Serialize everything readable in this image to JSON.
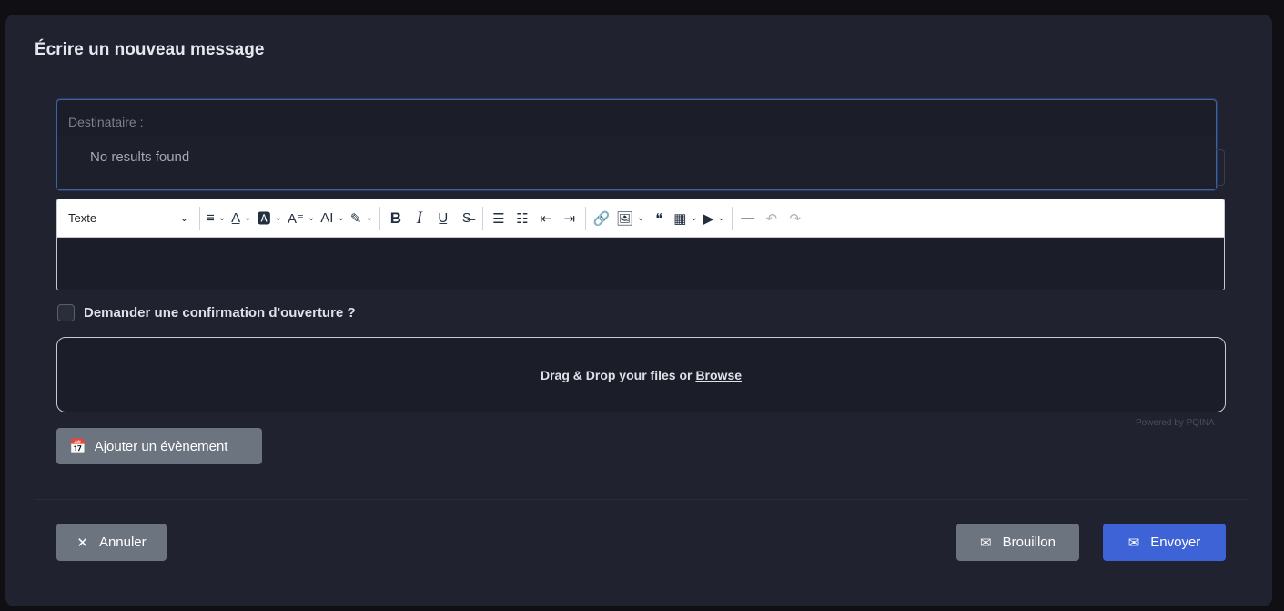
{
  "modal": {
    "title": "Écrire un nouveau message"
  },
  "recipient": {
    "label": "Destinataire :",
    "dropdown_message": "No results found"
  },
  "toolbar": {
    "format_select": "Texte",
    "buttons": [
      {
        "name": "align-icon",
        "glyph": "≡",
        "caret": true
      },
      {
        "name": "text-color-icon",
        "glyph": "A̲",
        "caret": true
      },
      {
        "name": "background-color-icon",
        "glyph": "🅰",
        "caret": true
      },
      {
        "name": "font-family-icon",
        "glyph": "A⁼",
        "caret": true
      },
      {
        "name": "font-size-icon",
        "glyph": "AI",
        "caret": true
      },
      {
        "name": "highlight-icon",
        "glyph": "✎",
        "caret": true
      },
      {
        "name": "bold-icon",
        "glyph": "B"
      },
      {
        "name": "italic-icon",
        "glyph": "I"
      },
      {
        "name": "underline-icon",
        "glyph": "U̲"
      },
      {
        "name": "strikethrough-icon",
        "glyph": "S̶"
      },
      {
        "name": "bullet-list-icon",
        "glyph": "☰"
      },
      {
        "name": "numbered-list-icon",
        "glyph": "☷"
      },
      {
        "name": "outdent-icon",
        "glyph": "⇤"
      },
      {
        "name": "indent-icon",
        "glyph": "⇥"
      },
      {
        "name": "link-icon",
        "glyph": "🔗"
      },
      {
        "name": "image-icon",
        "glyph": "🖼",
        "caret": true
      },
      {
        "name": "quote-icon",
        "glyph": "❝"
      },
      {
        "name": "table-icon",
        "glyph": "▦",
        "caret": true
      },
      {
        "name": "media-icon",
        "glyph": "▶",
        "caret": true
      },
      {
        "name": "horizontal-line-icon",
        "glyph": "—"
      },
      {
        "name": "undo-icon",
        "glyph": "↶",
        "dim": true
      },
      {
        "name": "redo-icon",
        "glyph": "↷",
        "dim": true
      }
    ]
  },
  "confirm": {
    "label": "Demander une confirmation d'ouverture ?"
  },
  "dropzone": {
    "text": "Drag & Drop your files or",
    "link": "Browse",
    "powered_by": "Powered by PQINA"
  },
  "event_button": {
    "label": "Ajouter un évènement"
  },
  "footer": {
    "cancel_label": "Annuler",
    "draft_label": "Brouillon",
    "send_label": "Envoyer"
  },
  "colors": {
    "background": "#202230",
    "primary": "#3e63d6",
    "secondary": "#6c7480"
  }
}
